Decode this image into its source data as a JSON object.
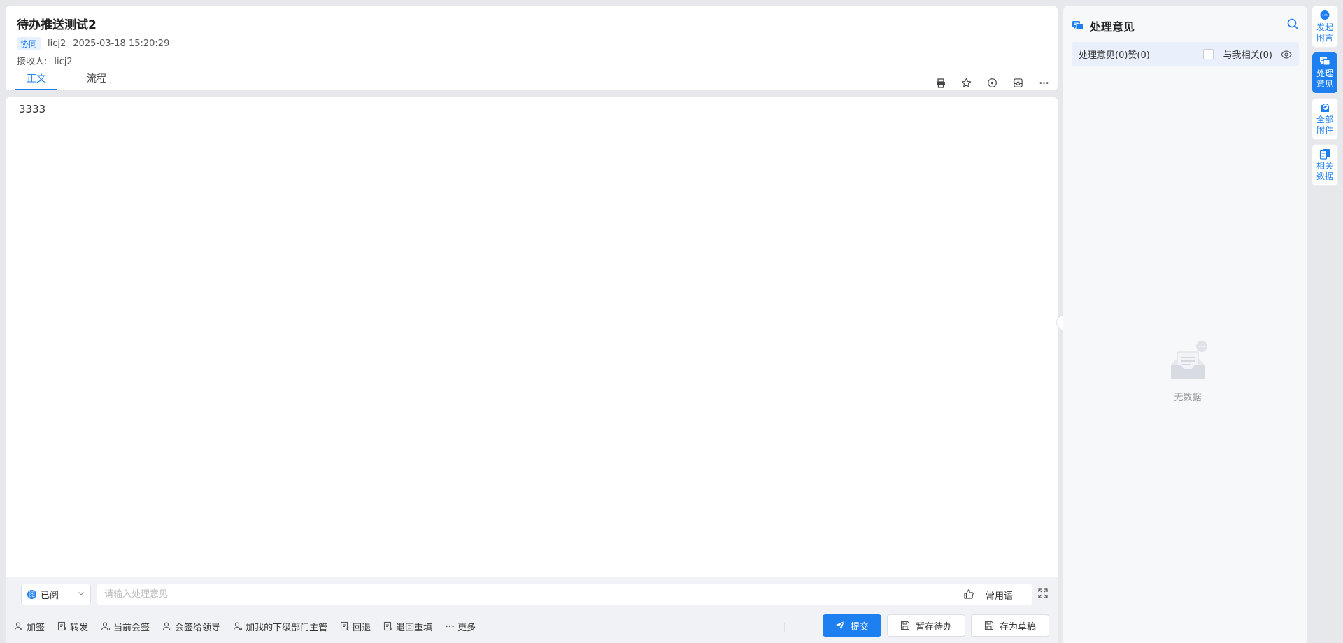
{
  "header": {
    "title": "待办推送测试2",
    "type_badge": "协同",
    "author": "licj2",
    "timestamp": "2025-03-18 15:20:29",
    "receiver_label": "接收人:",
    "receiver": "licj2",
    "tabs": [
      {
        "label": "正文",
        "active": true
      },
      {
        "label": "流程",
        "active": false
      }
    ],
    "tools": [
      "print-icon",
      "star-icon",
      "target-icon",
      "archive-icon",
      "more-icon"
    ]
  },
  "body": {
    "content": "3333"
  },
  "opinion": {
    "status_value": "已阅",
    "status_badge": "阅",
    "placeholder": "请输入处理意见",
    "phrases_label": "常用语"
  },
  "actions": [
    {
      "label": "加签",
      "icon": "user-add-icon"
    },
    {
      "label": "转发",
      "icon": "forward-icon"
    },
    {
      "label": "当前会签",
      "icon": "user-icon"
    },
    {
      "label": "会签给领导",
      "icon": "user-icon"
    },
    {
      "label": "加我的下级部门主管",
      "icon": "user-icon"
    },
    {
      "label": "回退",
      "icon": "rollback-icon"
    },
    {
      "label": "退回重填",
      "icon": "rollback-icon"
    },
    {
      "label": "更多",
      "icon": "ellipsis-icon"
    }
  ],
  "buttons": {
    "submit": "提交",
    "save_todo": "暂存待办",
    "save_draft": "存为草稿"
  },
  "panel": {
    "title": "处理意见",
    "count_label": "处理意见(0)赞(0)",
    "related_label": "与我相关(0)",
    "empty_label": "无数据"
  },
  "rail": [
    {
      "label": "发起附言",
      "icon": "chat-icon",
      "active": false
    },
    {
      "label": "处理意见",
      "icon": "comment-icon",
      "active": true
    },
    {
      "label": "全部附件",
      "icon": "attachment-icon",
      "active": false
    },
    {
      "label": "相关数据",
      "icon": "data-icon",
      "active": false
    }
  ],
  "colors": {
    "accent": "#1d7ff0",
    "background": "#e6e8eb",
    "panel": "#f7f8fa"
  }
}
